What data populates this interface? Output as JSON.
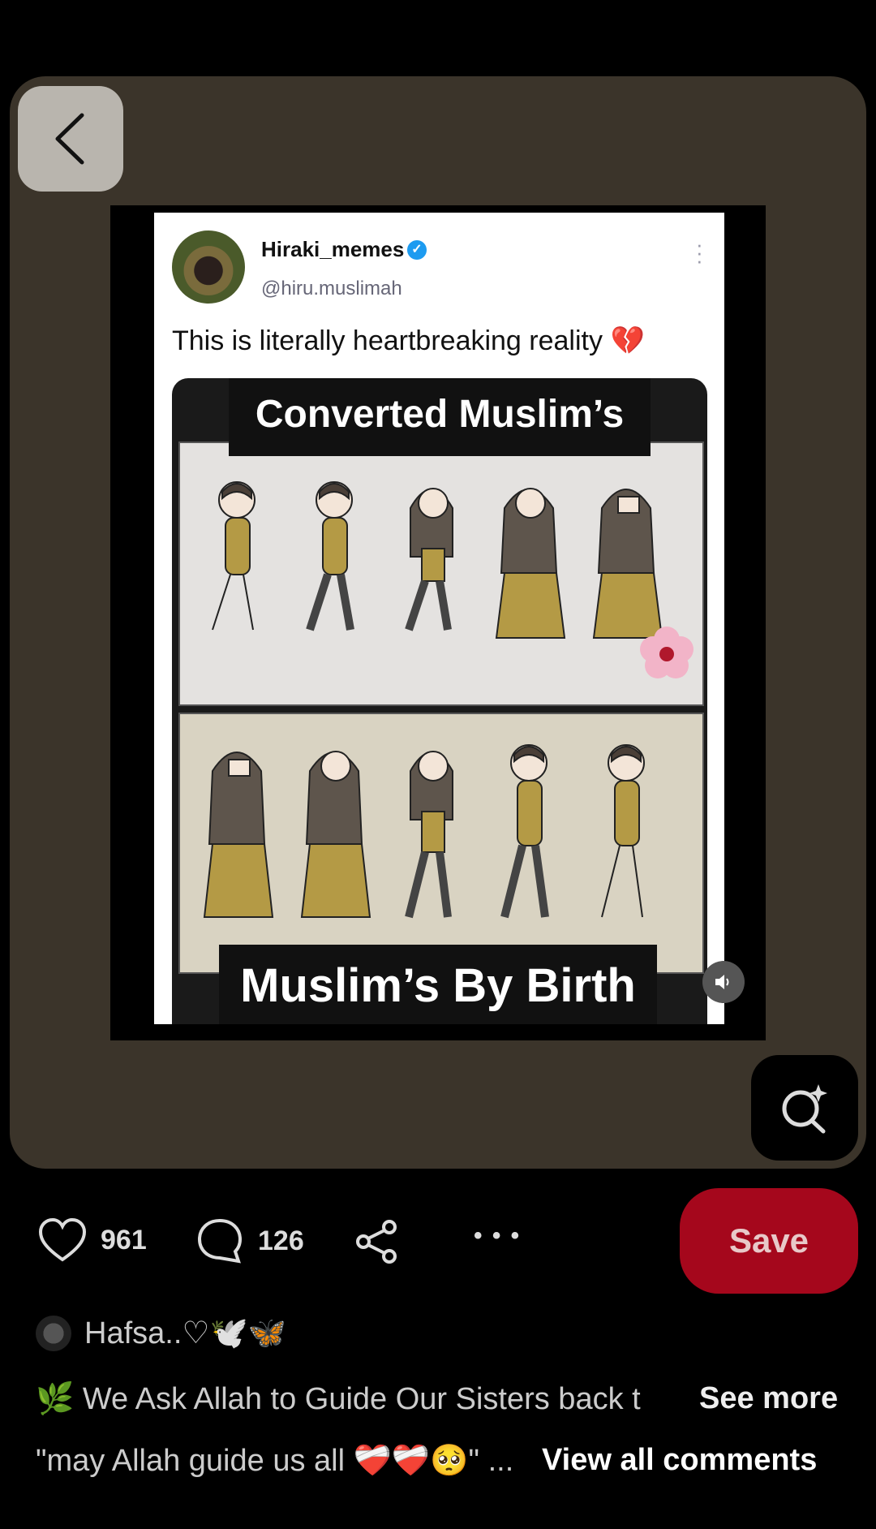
{
  "pin": {
    "tweet": {
      "name": "Hiraki_memes",
      "handle": "@hiru.muslimah",
      "text": "This is literally heartbreaking reality",
      "heart_emoji": "💔"
    },
    "comic": {
      "top_caption": "Converted Muslim’s",
      "bottom_caption": "Muslim’s By Birth"
    }
  },
  "actions": {
    "like_count": "961",
    "comment_count": "126",
    "more_label": "• • •",
    "save_label": "Save"
  },
  "author": {
    "name": "Hafsa..♡🕊️🦋"
  },
  "description": {
    "text": "🌿 We Ask Allah to Guide Our Sisters back t",
    "see_more": "See more"
  },
  "top_comment": {
    "text": "\"may Allah guide us all ❤️‍🩹❤️‍🩹🥺\" ...",
    "view_all": "View all comments"
  },
  "colors": {
    "card_bg": "#3b342a",
    "save_bg": "#a5071c",
    "verified": "#1d9bf0"
  }
}
